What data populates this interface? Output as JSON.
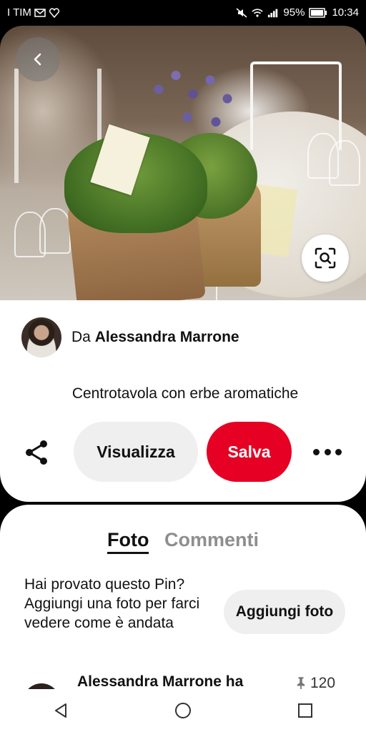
{
  "status_bar": {
    "carrier": "I TIM",
    "battery": "95%",
    "time": "10:34"
  },
  "pin": {
    "author_prefix": "Da",
    "author_name": "Alessandra Marrone",
    "title": "Centrotavola con erbe aromatiche"
  },
  "actions": {
    "visualizza_label": "Visualizza",
    "salva_label": "Salva",
    "accent_color": "#e60023"
  },
  "tabs": {
    "foto": "Foto",
    "commenti": "Commenti"
  },
  "prompt": {
    "text": "Hai provato questo Pin? Aggiungi una foto per farci vedere come è andata",
    "button_label": "Aggiungi foto"
  },
  "comment_preview": {
    "author_text": "Alessandra Marrone ha",
    "pin_count": "120"
  },
  "icons": {
    "back": "chevron-left-icon",
    "visual_search": "lens-search-icon",
    "share": "share-icon",
    "more": "more-icon",
    "pin": "pin-icon",
    "nav_back": "triangle-back-icon",
    "nav_home": "circle-home-icon",
    "nav_recents": "square-recents-icon"
  }
}
